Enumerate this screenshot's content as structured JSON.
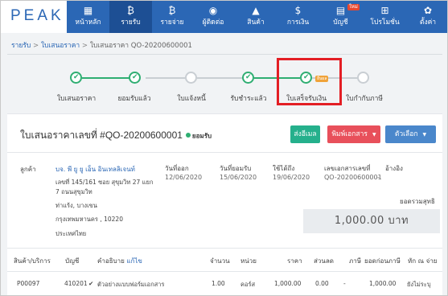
{
  "app": {
    "logo": "PEAK"
  },
  "nav": [
    {
      "label": "หน้าหลัก",
      "icon": "dashboard-icon",
      "glyph": "▦"
    },
    {
      "label": "รายรับ",
      "icon": "income-icon",
      "glyph": "₿"
    },
    {
      "label": "รายจ่าย",
      "icon": "expense-icon",
      "glyph": "₿"
    },
    {
      "label": "ผู้ติดต่อ",
      "icon": "contact-icon",
      "glyph": "◉"
    },
    {
      "label": "สินค้า",
      "icon": "product-icon",
      "glyph": "▲"
    },
    {
      "label": "การเงิน",
      "icon": "money-icon",
      "glyph": "$"
    },
    {
      "label": "บัญชี",
      "icon": "account-icon",
      "glyph": "▤",
      "badge": "ใหม่"
    },
    {
      "label": "โปรโมชั่น",
      "icon": "gift-icon",
      "glyph": "⊞"
    },
    {
      "label": "ตั้งค่า",
      "icon": "gear-icon",
      "glyph": "✿"
    }
  ],
  "breadcrumb": {
    "item1": "รายรับ",
    "item2": "ใบเสนอราคา",
    "current": "ใบเสนอราคา QO-20200600001",
    "sep": ">"
  },
  "steps": [
    {
      "label": "ใบเสนอราคา",
      "done": true
    },
    {
      "label": "ยอมรับแล้ว",
      "done": true
    },
    {
      "label": "ใบแจ้งหนี้",
      "done": false
    },
    {
      "label": "รับชำระแล้ว",
      "done": true
    },
    {
      "label": "ใบเสร็จรับเงิน",
      "done": true,
      "badge": "อื่นผล"
    },
    {
      "label": "ใบกำกับภาษี",
      "done": false
    }
  ],
  "doc": {
    "title": "ใบเสนอราคาเลขที่ #QO-20200600001",
    "status": "ยอมรับ",
    "btn_email": "ส่งอีเมล",
    "btn_print": "พิมพ์เอกสาร",
    "btn_options": "ตัวเลือก",
    "customer_label": "ลูกค้า",
    "customer_name": "บจ. พี ยู ยู เอ็น อินเทลลิเจนท์",
    "addr_line1": "เลขที่ 145/161 ซอย สุขุมวิท 27 แยก",
    "addr_line2": "7 ถนนสุขุมวิท",
    "addr_line3": "ท่าแร้ง, บางเขน",
    "addr_line4": "กรุงเทพมหานคร , 10220",
    "addr_line5": "ประเทศไทย",
    "issue_label": "วันที่ออก",
    "issue_date": "12/06/2020",
    "accept_label": "วันที่ยอมรับ",
    "accept_date": "15/06/2020",
    "valid_label": "ใช้ได้ถึง",
    "valid_date": "19/06/2020",
    "docno_label": "เลขเอกสารเลขที่",
    "docno": "QO-20200600001",
    "ref_label": "อ้างอิง",
    "ref": "-",
    "total_label": "ยอดรวมสุทธิ",
    "total": "1,000.00 บาท"
  },
  "table": {
    "headers": {
      "product": "สินค้า/บริการ",
      "account": "บัญชี",
      "desc": "คำอธิบาย",
      "edit": "แก้ไข",
      "qty": "จำนวน",
      "unit": "หน่วย",
      "price": "ราคา",
      "discount": "ส่วนลด",
      "vat": "ภาษี",
      "pretax": "ยอดก่อนภาษี",
      "wht": "หัก ณ จ่าย"
    },
    "rows": [
      {
        "product": "P00097",
        "account": "410201",
        "desc": "ตัวอย่างแบบฟอร์มเอกสาร",
        "qty": "1.00",
        "unit": "คอร์ส",
        "price": "1,000.00",
        "discount": "0.00",
        "vat": "-",
        "pretax": "1,000.00",
        "wht": "ยังไม่ระบุ"
      }
    ]
  },
  "colors": {
    "nav": "#2b67b5",
    "accent_green": "#2fae72",
    "btn_email": "#25b08c",
    "btn_print": "#e8505b",
    "btn_options": "#4a87cb",
    "highlight": "#e31e24"
  }
}
